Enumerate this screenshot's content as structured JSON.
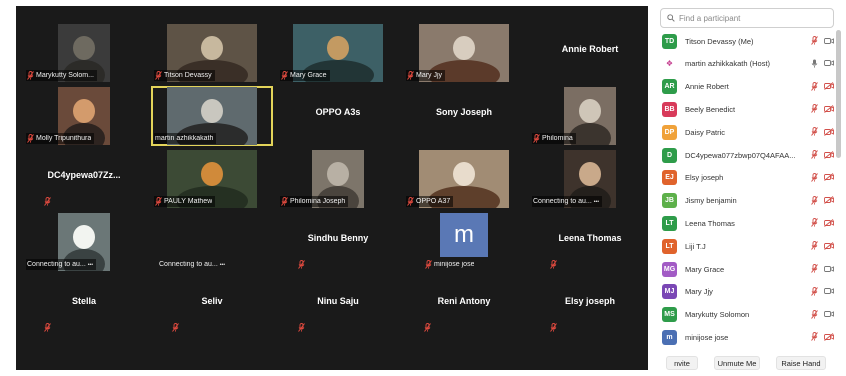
{
  "gallery": {
    "tiles": [
      {
        "name": "Marykutty Solom...",
        "type": "video",
        "muted": true,
        "bg": "#3b3b3b",
        "colors": [
          "#6e6a60",
          "#2c2b28"
        ]
      },
      {
        "name": "Titson Devassy",
        "type": "video",
        "muted": true,
        "bg": "#5e5346",
        "colors": [
          "#c7b89e",
          "#3a2f27"
        ]
      },
      {
        "name": "Mary Grace",
        "type": "video",
        "muted": true,
        "bg": "#3d6066",
        "colors": [
          "#c39a62",
          "#223536"
        ]
      },
      {
        "name": "Mary Jjy",
        "type": "video",
        "muted": true,
        "bg": "#8a7a6c",
        "colors": [
          "#d8cdbf",
          "#5b3a2a"
        ]
      },
      {
        "name": "Annie Robert",
        "type": "name",
        "muted": false
      },
      {
        "name": "Molly Tripunithura",
        "type": "video",
        "muted": true,
        "bg": "#6a4a3a",
        "colors": [
          "#d39b6c",
          "#2e2420"
        ]
      },
      {
        "name": "martin azhikkakath",
        "type": "video",
        "muted": false,
        "bg": "#5f6a6e",
        "colors": [
          "#c9c7bf",
          "#2b2c2c"
        ],
        "active": true
      },
      {
        "name": "OPPO A3s",
        "type": "name",
        "muted": false
      },
      {
        "name": "Sony Joseph",
        "type": "name",
        "muted": false
      },
      {
        "name": "Philomina",
        "type": "video",
        "muted": true,
        "bg": "#7b6e63",
        "colors": [
          "#cfc6b8",
          "#3b342e"
        ]
      },
      {
        "name": "DC4ypewa07Zz...",
        "type": "name",
        "muted": true
      },
      {
        "name": "PAULY Mathew",
        "type": "video",
        "muted": true,
        "bg": "#3c4a35",
        "colors": [
          "#d08a3a",
          "#253022"
        ]
      },
      {
        "name": "Philomina Joseph",
        "type": "video",
        "muted": true,
        "bg": "#7d756a",
        "colors": [
          "#b8b0a4",
          "#4a443d"
        ]
      },
      {
        "name": "OPPO A37",
        "type": "video",
        "muted": true,
        "bg": "#a18c74",
        "colors": [
          "#e8dccc",
          "#5e3f2b"
        ]
      },
      {
        "name": "Connecting to au...",
        "type": "video",
        "muted": false,
        "bg": "#3e332c",
        "colors": [
          "#c9a98a",
          "#24201c"
        ]
      },
      {
        "name": "Connecting to au...",
        "type": "video",
        "muted": false,
        "bg": "#6b7777",
        "colors": [
          "#f2f4f0",
          "#3a4242"
        ]
      },
      {
        "name": "Connecting to au...",
        "type": "empty",
        "muted": false
      },
      {
        "name": "Sindhu Benny",
        "type": "name",
        "muted": true
      },
      {
        "name": "minijose jose",
        "type": "letter",
        "letter": "m",
        "muted": true
      },
      {
        "name": "Leena Thomas",
        "type": "name",
        "muted": true
      },
      {
        "name": "Stella",
        "type": "name",
        "muted": true
      },
      {
        "name": "Seliv",
        "type": "name",
        "muted": true
      },
      {
        "name": "Ninu Saju",
        "type": "name",
        "muted": true
      },
      {
        "name": "Reni Antony",
        "type": "name",
        "muted": true
      },
      {
        "name": "Elsy joseph",
        "type": "name",
        "muted": true
      }
    ]
  },
  "panel": {
    "search_placeholder": "Find a participant",
    "participants": [
      {
        "initials": "TD",
        "name": "Titson Devassy (Me)",
        "color": "#2e9c4a",
        "mic": "muted",
        "cam": "on"
      },
      {
        "initials": "",
        "name": "martin azhikkakath (Host)",
        "color": "#c43b8d",
        "mic": "on",
        "cam": "on",
        "logo": true
      },
      {
        "initials": "AR",
        "name": "Annie Robert",
        "color": "#2e9c4a",
        "mic": "muted",
        "cam": "off"
      },
      {
        "initials": "BB",
        "name": "Beely Benedict",
        "color": "#d83a5a",
        "mic": "muted",
        "cam": "off"
      },
      {
        "initials": "DP",
        "name": "Daisy Patric",
        "color": "#f0a23a",
        "mic": "muted",
        "cam": "off"
      },
      {
        "initials": "D",
        "name": "DC4ypewa077zbwp07Q4AFAA...",
        "color": "#2e9c4a",
        "mic": "muted",
        "cam": "off"
      },
      {
        "initials": "EJ",
        "name": "Elsy joseph",
        "color": "#e0632c",
        "mic": "muted",
        "cam": "off"
      },
      {
        "initials": "JB",
        "name": "Jismy benjamin",
        "color": "#5db04a",
        "mic": "muted",
        "cam": "off"
      },
      {
        "initials": "LT",
        "name": "Leena Thomas",
        "color": "#2e9c4a",
        "mic": "muted",
        "cam": "off"
      },
      {
        "initials": "LT",
        "name": "Liji T.J",
        "color": "#e0632c",
        "mic": "muted",
        "cam": "off"
      },
      {
        "initials": "MG",
        "name": "Mary Grace",
        "color": "#a25bc5",
        "mic": "muted",
        "cam": "on"
      },
      {
        "initials": "MJ",
        "name": "Mary Jjy",
        "color": "#7a47b5",
        "mic": "muted",
        "cam": "on"
      },
      {
        "initials": "MS",
        "name": "Marykutty Solomon",
        "color": "#2e9c4a",
        "mic": "muted",
        "cam": "on"
      },
      {
        "initials": "m",
        "name": "minijose jose",
        "color": "#4b6fb3",
        "mic": "muted",
        "cam": "off"
      }
    ],
    "footer": {
      "invite": "nvite",
      "unmute": "Unmute Me",
      "raise": "Raise Hand"
    }
  }
}
